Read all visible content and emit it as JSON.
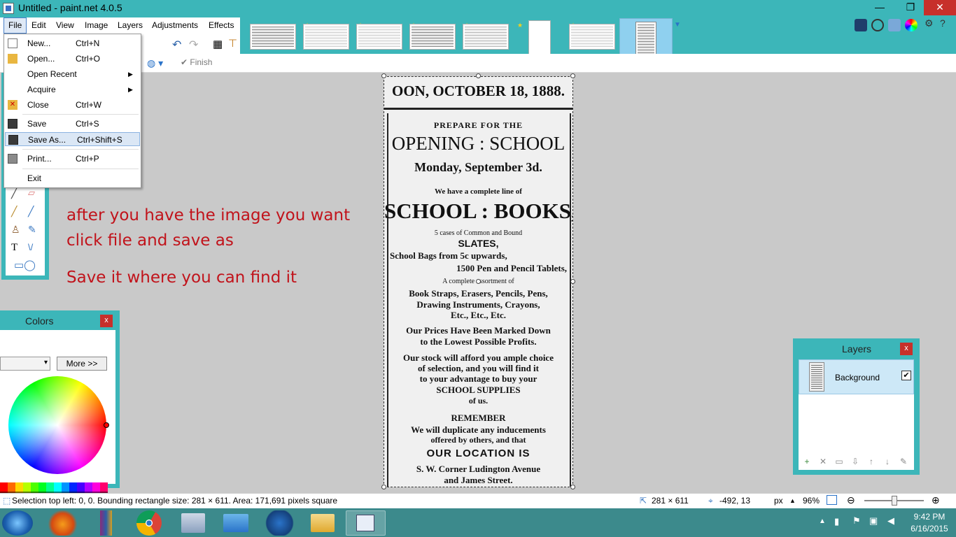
{
  "window": {
    "title": "Untitled - paint.net 4.0.5",
    "min": "—",
    "max": "❐",
    "close": "✕"
  },
  "menubar": [
    "File",
    "Edit",
    "View",
    "Image",
    "Layers",
    "Adjustments",
    "Effects"
  ],
  "toolbar": {
    "finish_label": "Finish"
  },
  "file_menu": {
    "items": [
      {
        "label": "New...",
        "shortcut": "Ctrl+N"
      },
      {
        "label": "Open...",
        "shortcut": "Ctrl+O"
      },
      {
        "label": "Open Recent",
        "shortcut": "",
        "submenu": true
      },
      {
        "label": "Acquire",
        "shortcut": "",
        "submenu": true
      },
      {
        "label": "Close",
        "shortcut": "Ctrl+W"
      },
      {
        "label": "Save",
        "shortcut": "Ctrl+S"
      },
      {
        "label": "Save As...",
        "shortcut": "Ctrl+Shift+S"
      },
      {
        "label": "Print...",
        "shortcut": "Ctrl+P"
      },
      {
        "label": "Exit",
        "shortcut": ""
      }
    ],
    "highlighted": "Save As..."
  },
  "annotation": {
    "line1": "after you have the image you want",
    "line2": "click file and save as",
    "line3": "Save it where you can find it"
  },
  "newspaper": {
    "header": "OON, OCTOBER 18, 1888.",
    "l1": "PREPARE FOR THE",
    "l2": "OPENING : SCHOOL",
    "l3": "Monday, September 3d.",
    "l4": "We have a complete line of",
    "l5": "SCHOOL : BOOKS,",
    "l6": "5 cases of Common and Bound",
    "l7": "SLATES,",
    "l8": "School Bags from 5c upwards,",
    "l9": "1500 Pen and Pencil Tablets,",
    "l10": "A complete assortment of",
    "l11": "Book Straps, Erasers, Pencils, Pens,",
    "l12": "Drawing Instruments, Crayons,",
    "l13": "Etc., Etc., Etc.",
    "l14": "Our Prices Have Been Marked Down",
    "l15": "to the Lowest Possible Profits.",
    "l16": "Our stock will afford you ample choice",
    "l17": "of selection, and you will find it",
    "l18": "to your advantage to buy your",
    "l19": "SCHOOL SUPPLIES",
    "l20": "of us.",
    "l21": "REMEMBER",
    "l22": "We will duplicate any inducements",
    "l23": "offered by others, and that",
    "l24": "OUR LOCATION IS",
    "l25": "S. W. Corner Ludington Avenue",
    "l26": "and James Street."
  },
  "colors_panel": {
    "title": "Colors",
    "more_label": "More >>",
    "close": "x"
  },
  "layers_panel": {
    "title": "Layers",
    "layer_name": "Background",
    "close": "x",
    "checked": "✔"
  },
  "statusbar": {
    "selection_text": "Selection top left: 0, 0. Bounding rectangle size: 281 × 611. Area: 171,691 pixels square",
    "size": "281 × 611",
    "cursor": "-492, 13",
    "unit": "px",
    "zoom": "96%"
  },
  "taskbar": {
    "time": "9:42 PM",
    "date": "6/16/2015"
  },
  "colors": {
    "accent": "#3cb6b9",
    "close_red": "#c7302b",
    "annotation_red": "#c1131b",
    "selection_blue": "#dbe7f5"
  }
}
